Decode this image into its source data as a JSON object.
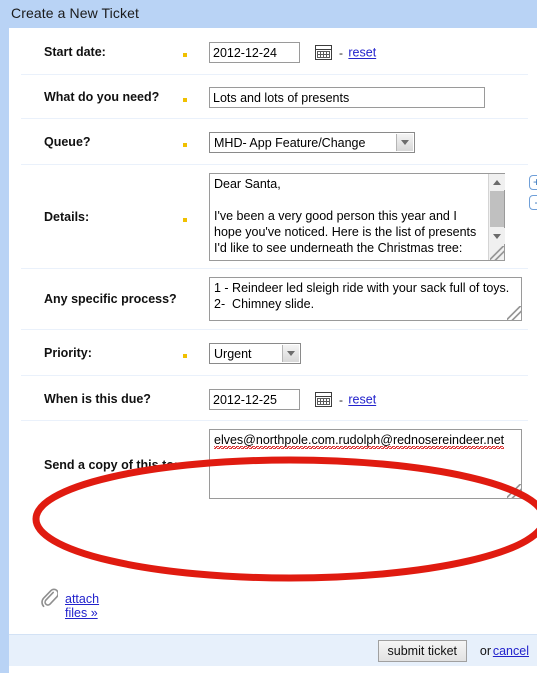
{
  "window": {
    "title": "Create a New Ticket"
  },
  "form": {
    "rows": [
      {
        "label": "Start date:",
        "required": true,
        "value": "2012-12-24",
        "reset_label": "reset",
        "separator": "-",
        "calendar_icon": "calendar-icon"
      },
      {
        "label": "What do you need?",
        "required": true,
        "value": "Lots and lots of presents"
      },
      {
        "label": "Queue?",
        "required": true,
        "value": "MHD- App Feature/Change"
      },
      {
        "label": "Details:",
        "required": true,
        "value": "Dear Santa,\n\nI've been a very good person this year and I hope you've noticed. Here is the list of presents I'd like to see underneath the Christmas tree:",
        "plus_label": "+",
        "minus_label": "-"
      },
      {
        "label": "Any specific process?",
        "required": false,
        "value": "1 - Reindeer led sleigh ride with your sack full of toys.\n2-  Chimney slide."
      },
      {
        "label": "Priority:",
        "required": true,
        "value": "Urgent"
      },
      {
        "label": "When is this due?",
        "required": false,
        "value": "2012-12-25",
        "reset_label": "reset",
        "separator": "-",
        "calendar_icon": "calendar-icon"
      },
      {
        "label": "Send a copy of this to:",
        "required": false,
        "value": "elves@northpole.com.rudolph@rednosereindeer.net"
      }
    ]
  },
  "attachments": {
    "icon": "paperclip-icon",
    "link_label": "attach files »"
  },
  "footer": {
    "submit_label": "submit ticket",
    "or_label": "or",
    "cancel_label": "cancel"
  },
  "annotation": {
    "shape": "ellipse",
    "color": "#e01b10",
    "target": "Send a copy of this to:"
  },
  "colors": {
    "titlebar": "#b9d3f5",
    "footer": "#e7f0fb",
    "link": "#2222cc",
    "required_marker": "#f0c000",
    "annotation": "#e01b10"
  }
}
